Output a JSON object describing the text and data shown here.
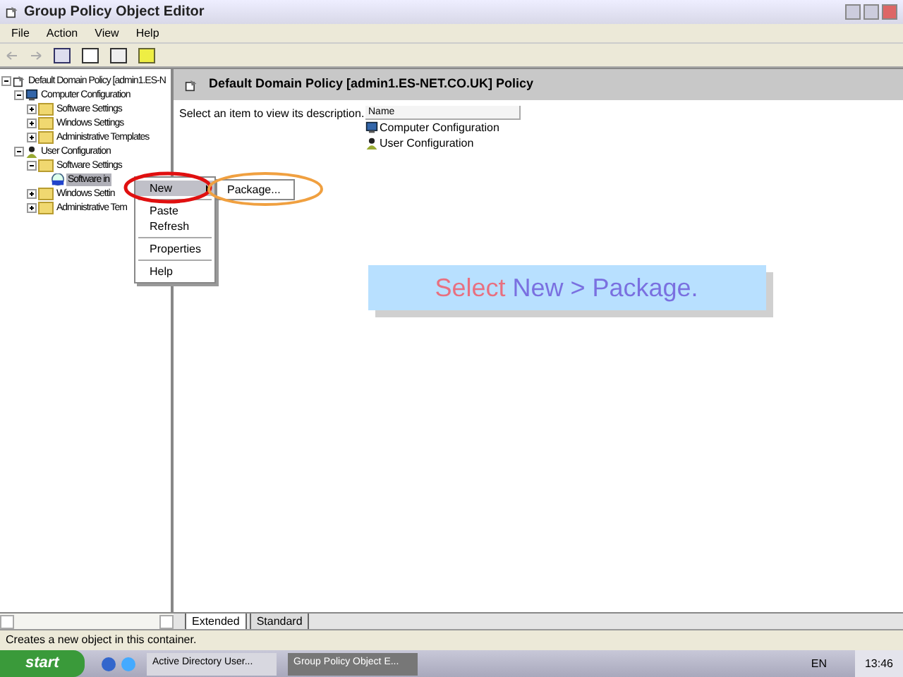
{
  "window": {
    "title": "Group Policy Object Editor"
  },
  "menu_bar": [
    "File",
    "Action",
    "View",
    "Help"
  ],
  "tree": [
    {
      "label": "Default Domain Policy [admin1.ES-N",
      "kind": "policy",
      "expanded": true,
      "children": [
        {
          "label": "Computer Configuration",
          "kind": "computer",
          "expanded": true,
          "children": [
            {
              "label": "Software Settings",
              "kind": "folder",
              "expanded": false,
              "selected": false
            },
            {
              "label": "Windows Settings",
              "kind": "folder",
              "expanded": false,
              "selected": false
            },
            {
              "label": "Administrative Templates",
              "kind": "folder",
              "expanded": false,
              "selected": false
            }
          ]
        },
        {
          "label": "User Configuration",
          "kind": "user",
          "expanded": true,
          "children": [
            {
              "label": "Software Settings",
              "kind": "folder",
              "expanded": true,
              "selected": false,
              "children": [
                {
                  "label": "Software in",
                  "kind": "package",
                  "selected": true
                }
              ]
            },
            {
              "label": "Windows Settin",
              "kind": "folder",
              "expanded": false,
              "selected": false
            },
            {
              "label": "Administrative Tem",
              "kind": "folder",
              "expanded": false,
              "selected": false
            }
          ]
        }
      ]
    }
  ],
  "details": {
    "title": "Default Domain Policy [admin1.ES-NET.CO.UK] Policy",
    "description": "Select an item to view its description.",
    "columns": [
      "Name"
    ],
    "items": [
      {
        "label": "Computer Configuration",
        "kind": "computer"
      },
      {
        "label": "User Configuration",
        "kind": "user"
      }
    ]
  },
  "context_menu": {
    "items": [
      {
        "kind": "item",
        "label": "New",
        "submenu": true,
        "selected": true
      },
      {
        "kind": "separator"
      },
      {
        "kind": "item",
        "label": "Paste",
        "submenu": false,
        "selected": false
      },
      {
        "kind": "item",
        "label": "Refresh",
        "submenu": false,
        "selected": false
      },
      {
        "kind": "separator"
      },
      {
        "kind": "item",
        "label": "Properties",
        "submenu": false,
        "selected": false
      },
      {
        "kind": "separator"
      },
      {
        "kind": "item",
        "label": "Help",
        "submenu": false,
        "selected": false
      }
    ],
    "submenu": [
      "Package..."
    ]
  },
  "callout": {
    "parts": [
      {
        "text": "Select",
        "color": "#e87080"
      },
      {
        "text": "New > Package.",
        "color": "#7a70e0"
      }
    ]
  },
  "view_tabs": [
    {
      "label": "Extended",
      "selected": true
    },
    {
      "label": "Standard",
      "selected": false
    }
  ],
  "status_bar": "Creates a new object in this container.",
  "taskbar": {
    "start": "start",
    "tasks": [
      {
        "label": "Active Directory User...",
        "selected": false
      },
      {
        "label": "Group Policy Object E...",
        "selected": true
      }
    ],
    "language": "EN",
    "clock": "13:46"
  }
}
